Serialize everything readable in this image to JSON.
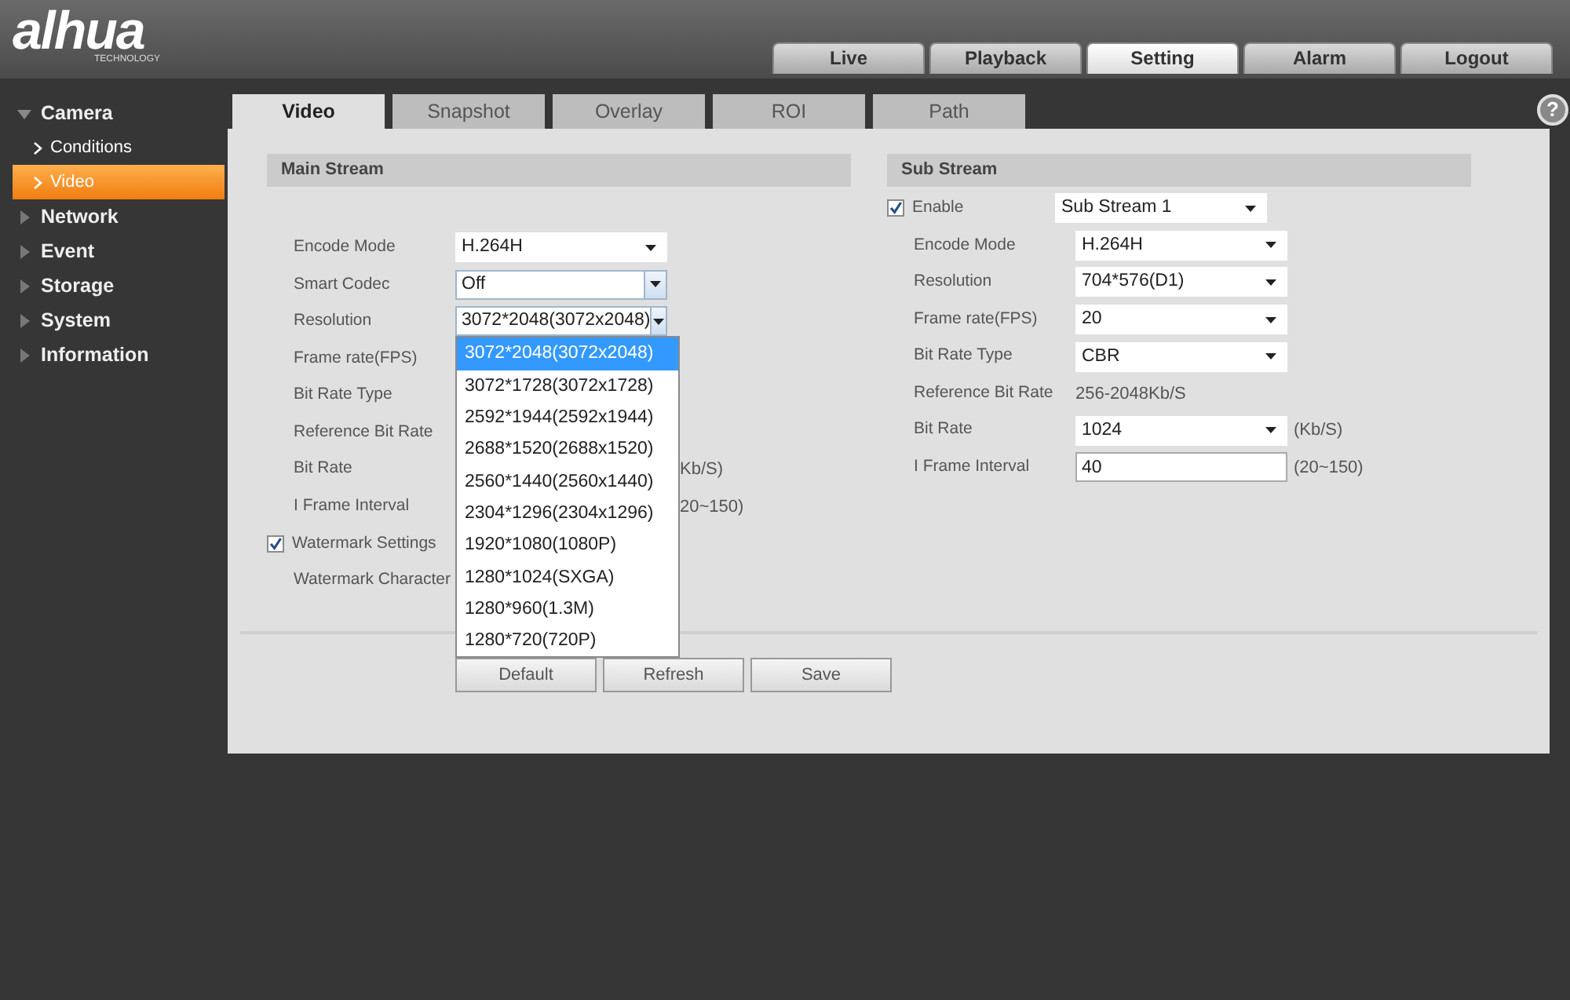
{
  "logo": {
    "text": "alhua",
    "subtext": "TECHNOLOGY"
  },
  "top_nav": [
    {
      "label": "Live",
      "selected": false
    },
    {
      "label": "Playback",
      "selected": false
    },
    {
      "label": "Setting",
      "selected": true
    },
    {
      "label": "Alarm",
      "selected": false
    },
    {
      "label": "Logout",
      "selected": false
    }
  ],
  "sidebar": {
    "items": [
      {
        "label": "Camera",
        "expanded": true,
        "children": [
          {
            "label": "Conditions",
            "selected": false
          },
          {
            "label": "Video",
            "selected": true
          }
        ]
      },
      {
        "label": "Network",
        "expanded": false
      },
      {
        "label": "Event",
        "expanded": false
      },
      {
        "label": "Storage",
        "expanded": false
      },
      {
        "label": "System",
        "expanded": false
      },
      {
        "label": "Information",
        "expanded": false
      }
    ]
  },
  "tabs": [
    {
      "label": "Video",
      "selected": true
    },
    {
      "label": "Snapshot",
      "selected": false
    },
    {
      "label": "Overlay",
      "selected": false
    },
    {
      "label": "ROI",
      "selected": false
    },
    {
      "label": "Path",
      "selected": false
    }
  ],
  "help": "?",
  "main_stream": {
    "title": "Main Stream",
    "rows": [
      {
        "kind": "select",
        "label": "Encode Mode",
        "value": "H.264H",
        "focused": false
      },
      {
        "kind": "select",
        "label": "Smart Codec",
        "value": "Off",
        "focused": true
      },
      {
        "kind": "select",
        "label": "Resolution",
        "value": "3072*2048(3072x2048)",
        "focused": true,
        "open": true
      },
      {
        "kind": "covered",
        "label": "Frame rate(FPS)"
      },
      {
        "kind": "covered",
        "label": "Bit Rate Type"
      },
      {
        "kind": "covered",
        "label": "Reference Bit Rate"
      },
      {
        "kind": "covered",
        "label": "Bit Rate",
        "suffix": "Kb/S)"
      },
      {
        "kind": "covered",
        "label": "I Frame Interval",
        "suffix": "20~150)"
      },
      {
        "kind": "checkbox",
        "label": "Watermark Settings",
        "checked": true
      },
      {
        "kind": "covered",
        "label": "Watermark Character"
      }
    ]
  },
  "dropdown": {
    "options": [
      {
        "label": "3072*2048(3072x2048)",
        "selected": true
      },
      {
        "label": "3072*1728(3072x1728)",
        "selected": false
      },
      {
        "label": "2592*1944(2592x1944)",
        "selected": false
      },
      {
        "label": "2688*1520(2688x1520)",
        "selected": false
      },
      {
        "label": "2560*1440(2560x1440)",
        "selected": false
      },
      {
        "label": "2304*1296(2304x1296)",
        "selected": false
      },
      {
        "label": "1920*1080(1080P)",
        "selected": false
      },
      {
        "label": "1280*1024(SXGA)",
        "selected": false
      },
      {
        "label": "1280*960(1.3M)",
        "selected": false
      },
      {
        "label": "1280*720(720P)",
        "selected": false
      }
    ]
  },
  "sub_stream": {
    "title": "Sub Stream",
    "rows": [
      {
        "kind": "check_select",
        "label": "Enable",
        "checked": true,
        "value": "Sub Stream 1",
        "focused": false
      },
      {
        "kind": "select",
        "label": "Encode Mode",
        "value": "H.264H",
        "focused": false
      },
      {
        "kind": "select",
        "label": "Resolution",
        "value": "704*576(D1)",
        "focused": false
      },
      {
        "kind": "select",
        "label": "Frame rate(FPS)",
        "value": "20",
        "focused": false
      },
      {
        "kind": "select",
        "label": "Bit Rate Type",
        "value": "CBR",
        "focused": false
      },
      {
        "kind": "text",
        "label": "Reference Bit Rate",
        "value": "256-2048Kb/S"
      },
      {
        "kind": "select",
        "label": "Bit Rate",
        "value": "1024",
        "focused": false,
        "unit": "(Kb/S)"
      },
      {
        "kind": "input",
        "label": "I Frame Interval",
        "value": "40",
        "unit": "(20~150)"
      }
    ]
  },
  "buttons": [
    "Default",
    "Refresh",
    "Save"
  ]
}
